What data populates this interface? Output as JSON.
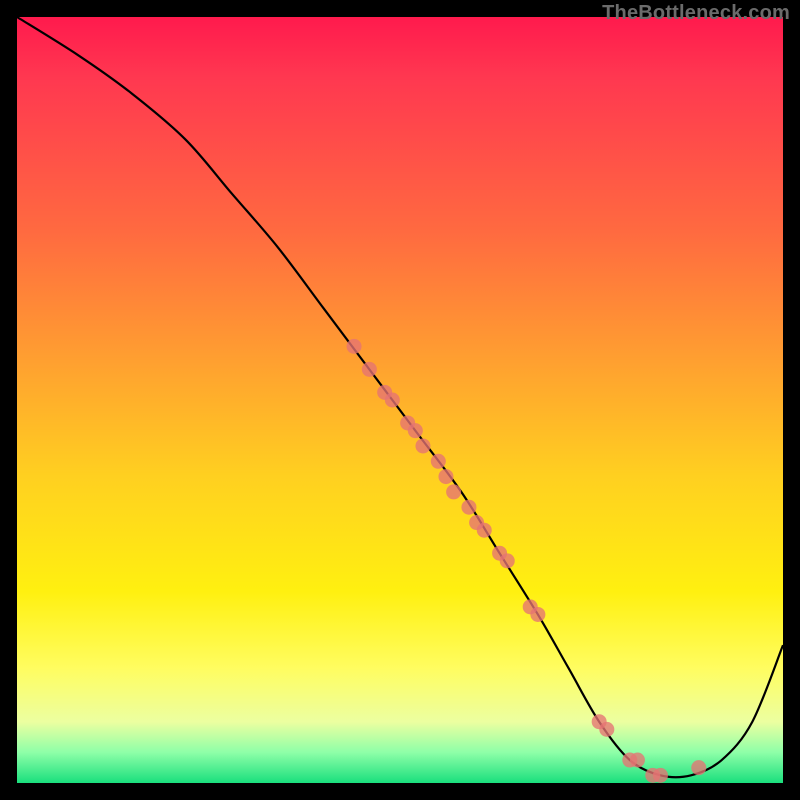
{
  "watermark": "TheBottleneck.com",
  "chart_data": {
    "type": "line",
    "title": "",
    "xlabel": "",
    "ylabel": "",
    "xlim": [
      0,
      100
    ],
    "ylim": [
      0,
      100
    ],
    "curve": {
      "x": [
        0,
        8,
        15,
        22,
        28,
        34,
        40,
        46,
        52,
        58,
        63,
        68,
        72,
        76,
        80,
        84,
        88,
        92,
        96,
        100
      ],
      "y": [
        100,
        95,
        90,
        84,
        77,
        70,
        62,
        54,
        46,
        38,
        30,
        22,
        15,
        8,
        3,
        1,
        1,
        3,
        8,
        18
      ]
    },
    "series": [
      {
        "name": "points-on-curve",
        "x": [
          44,
          46,
          48,
          49,
          51,
          52,
          53,
          55,
          56,
          57,
          59,
          60,
          61,
          63,
          64,
          67,
          68,
          76,
          77,
          80,
          81,
          83,
          84,
          89
        ],
        "y": [
          57,
          54,
          51,
          50,
          47,
          46,
          44,
          42,
          40,
          38,
          36,
          34,
          33,
          30,
          29,
          23,
          22,
          8,
          7,
          3,
          3,
          1,
          1,
          2
        ]
      }
    ],
    "background_gradient": {
      "top": "#ff1a4d",
      "middle": "#ffe020",
      "bottom": "#1adf7d"
    }
  }
}
